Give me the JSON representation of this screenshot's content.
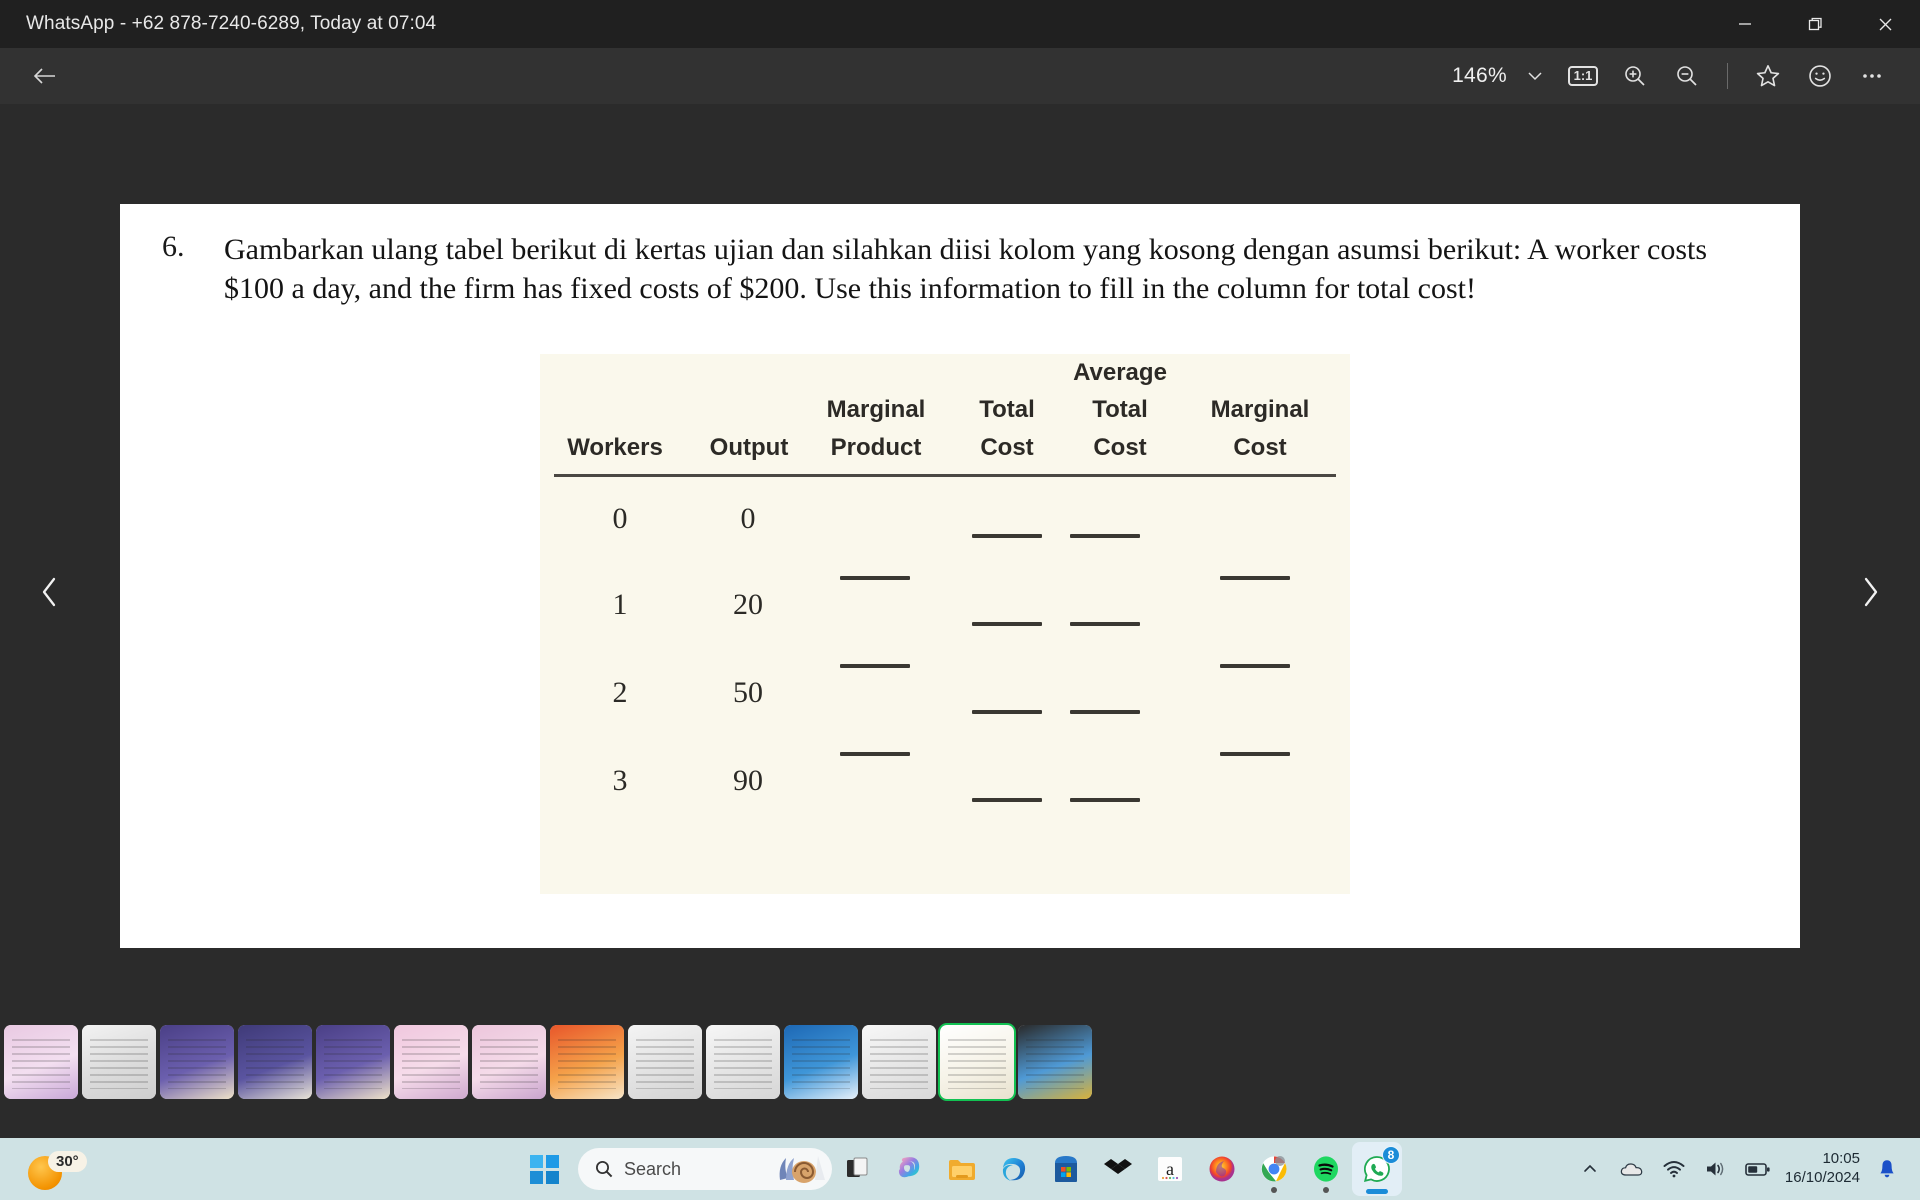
{
  "window": {
    "title": "WhatsApp - +62 878-7240-6289, Today at 07:04",
    "minimize_label": "Minimize",
    "restore_label": "Restore",
    "close_label": "Close"
  },
  "toolbar": {
    "back_label": "Back",
    "zoom_level": "146%",
    "zoom_dropdown_label": "Zoom options",
    "actual_size_label": "1:1",
    "zoom_in_label": "Zoom in",
    "zoom_out_label": "Zoom out",
    "favorite_label": "Add to favorites",
    "emoji_label": "React",
    "more_label": "More options"
  },
  "viewer": {
    "prev_label": "Previous",
    "next_label": "Next"
  },
  "document": {
    "question_number": "6.",
    "question_text": "Gambarkan ulang tabel berikut di kertas ujian dan silahkan diisi kolom yang kosong dengan asumsi berikut: A worker costs $100 a day, and the firm has fixed costs of $200. Use this information to fill in the column for total cost!",
    "table": {
      "headers": [
        {
          "top": "",
          "bottom": "Workers"
        },
        {
          "top": "",
          "bottom": "Output"
        },
        {
          "top": "Marginal",
          "bottom": "Product"
        },
        {
          "top": "Total",
          "bottom": "Cost"
        },
        {
          "top": "Average Total",
          "bottom": "Cost"
        },
        {
          "top": "Marginal",
          "bottom": "Cost"
        }
      ],
      "header_average": "Average",
      "rows": [
        {
          "workers": "0",
          "output": "0",
          "marginal_product": "",
          "total_cost": "",
          "average_total_cost": "",
          "marginal_cost": ""
        },
        {
          "workers": "1",
          "output": "20",
          "marginal_product": "",
          "total_cost": "",
          "average_total_cost": "",
          "marginal_cost": ""
        },
        {
          "workers": "2",
          "output": "50",
          "marginal_product": "",
          "total_cost": "",
          "average_total_cost": "",
          "marginal_cost": ""
        },
        {
          "workers": "3",
          "output": "90",
          "marginal_product": "",
          "total_cost": "",
          "average_total_cost": "",
          "marginal_cost": ""
        }
      ]
    }
  },
  "filmstrip": {
    "thumbnails": [
      {
        "name": "poster-pekan-prestasi-mahasiswa-1",
        "selected": false
      },
      {
        "name": "document-screenshot-1",
        "selected": false
      },
      {
        "name": "poster-kompetisi-debat-1",
        "selected": false
      },
      {
        "name": "poster-fotografi",
        "selected": false
      },
      {
        "name": "poster-kompetisi-debat-2",
        "selected": false
      },
      {
        "name": "poster-pekan-prestasi-mahasiswa-2",
        "selected": false
      },
      {
        "name": "poster-pekan-prestasi-mahasiswa-3",
        "selected": false
      },
      {
        "name": "poster-pom",
        "selected": false
      },
      {
        "name": "document-soal-1",
        "selected": false
      },
      {
        "name": "document-soal-tabel",
        "selected": false
      },
      {
        "name": "poster-webinar-nasional",
        "selected": false
      },
      {
        "name": "document-soal-list",
        "selected": false
      },
      {
        "name": "document-soal-tabel-current",
        "selected": true
      },
      {
        "name": "screenshot-spin-wheel",
        "selected": false
      }
    ]
  },
  "taskbar": {
    "weather_temp": "30°",
    "start_label": "Start",
    "search_placeholder": "Search",
    "apps": [
      {
        "name": "task-view",
        "label": "Task View",
        "running": false,
        "active": false
      },
      {
        "name": "copilot",
        "label": "Copilot",
        "running": false,
        "active": false
      },
      {
        "name": "file-explorer",
        "label": "File Explorer",
        "running": false,
        "active": false
      },
      {
        "name": "microsoft-edge",
        "label": "Microsoft Edge",
        "running": false,
        "active": false
      },
      {
        "name": "microsoft-store",
        "label": "Microsoft Store",
        "running": false,
        "active": false
      },
      {
        "name": "dropbox",
        "label": "Dropbox",
        "running": false,
        "active": false
      },
      {
        "name": "amazon",
        "label": "Amazon",
        "running": false,
        "active": false
      },
      {
        "name": "firefox",
        "label": "Firefox",
        "running": false,
        "active": false
      },
      {
        "name": "google-chrome",
        "label": "Google Chrome",
        "running": true,
        "active": false
      },
      {
        "name": "spotify",
        "label": "Spotify",
        "running": true,
        "active": false
      },
      {
        "name": "whatsapp",
        "label": "WhatsApp",
        "running": true,
        "active": true,
        "badge": "8"
      }
    ],
    "tray": {
      "overflow_label": "Show hidden icons",
      "onedrive_label": "OneDrive",
      "network_label": "Network",
      "volume_label": "Volume",
      "battery_label": "Battery",
      "time": "10:05",
      "date": "16/10/2024",
      "notifications_label": "Notifications"
    }
  },
  "colors": {
    "titlebar": "#202020",
    "toolbar": "#323232",
    "viewer_bg": "#2b2b2b",
    "document_bg": "#ffffff",
    "table_bg": "#faf8ec",
    "taskbar": "#cfe2e4",
    "accent": "#1b8cd8",
    "selected_thumb": "#12c152"
  }
}
